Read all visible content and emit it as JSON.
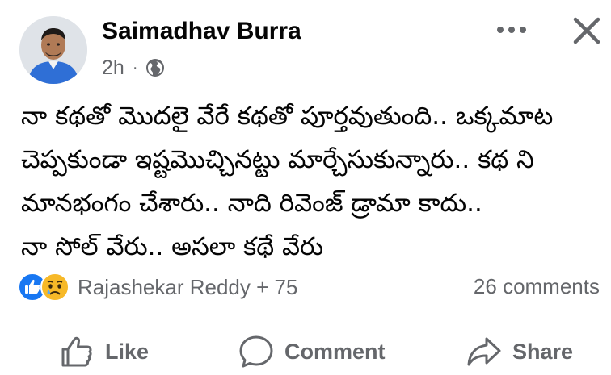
{
  "post": {
    "author": "Saimadhav Burra",
    "time": "2h",
    "separator": "·",
    "privacy_icon": "globe-icon",
    "lines": [
      "నా కథతో మొదలై వేరే కథతో పూర్తవుతుంది.. ఒక్కమాట",
      "చెప్పకుండా ఇష్టమొచ్చినట్టు మార్చేసుకున్నారు.. కథ ని",
      "మానభంగం చేశారు.. నాది రివెంజ్ డ్రామా కాదు..",
      "నా సోల్ వేరు.. అసలా కథే వేరు"
    ]
  },
  "reactions": {
    "icons": [
      "like-reaction-icon",
      "sad-reaction-icon"
    ],
    "summary": "Rajashekar Reddy + 75",
    "comments": "26 comments"
  },
  "actions": {
    "like": "Like",
    "comment": "Comment",
    "share": "Share"
  },
  "colors": {
    "like_blue": "#1877f2",
    "secondary_text": "#65676b",
    "sad_yellow": "#f7b928"
  }
}
